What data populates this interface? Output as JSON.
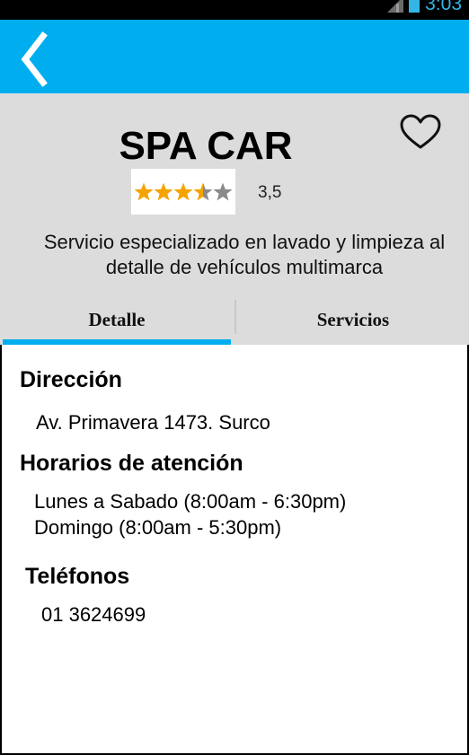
{
  "status_bar": {
    "time": "3:03",
    "icons": [
      "signal-icon",
      "battery-icon"
    ]
  },
  "app_bar": {
    "back_icon": "chevron-left-icon",
    "color": "#00aeef"
  },
  "business": {
    "name": "SPA CAR",
    "rating_value": "3,5",
    "rating": 3.5,
    "rating_max": 5,
    "description_line1": "Servicio especializado en lavado y limpieza al",
    "description_line2": "detalle de vehículos multimarca",
    "favorite_icon": "heart-outline-icon"
  },
  "tabs": [
    {
      "label": "Detalle",
      "active": true
    },
    {
      "label": "Servicios",
      "active": false
    }
  ],
  "detail": {
    "address_heading": "Dirección",
    "address": "Av. Primavera 1473. Surco",
    "hours_heading": "Horarios de atención",
    "hours_line1": "Lunes a Sabado (8:00am - 6:30pm)",
    "hours_line2": "Domingo (8:00am - 5:30pm)",
    "phones_heading": "Teléfonos",
    "phone": "01 3624699"
  },
  "colors": {
    "accent": "#00aeef",
    "header_bg": "#dcdcdc",
    "star_filled": "#f4a300",
    "star_empty": "#8a8a8a"
  }
}
